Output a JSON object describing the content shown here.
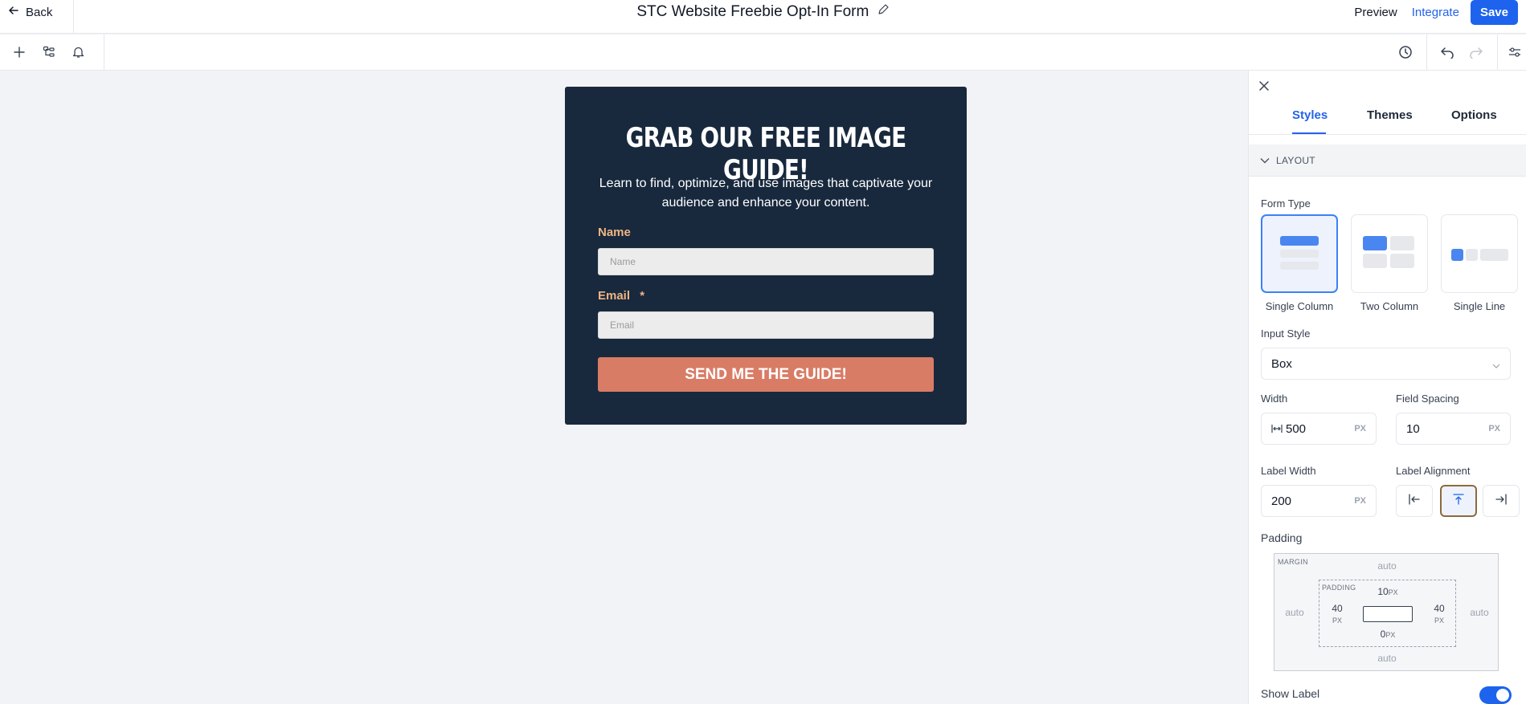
{
  "header": {
    "back_label": "Back",
    "form_title": "STC Website Freebie Opt-In Form",
    "preview_label": "Preview",
    "integrate_label": "Integrate",
    "save_label": "Save"
  },
  "toolbar": {
    "left_icons": [
      "plus-icon",
      "layers-icon",
      "bell-icon"
    ],
    "right_icons": [
      "history-icon",
      "undo-icon",
      "redo-icon",
      "sliders-icon"
    ]
  },
  "form": {
    "heading": "GRAB OUR FREE IMAGE GUIDE!",
    "subheading": "Learn to find, optimize, and use images that captivate your audience and enhance your content.",
    "name_label": "Name",
    "name_placeholder": "Name",
    "email_label": "Email",
    "email_required": "*",
    "email_placeholder": "Email",
    "button_label": "SEND ME THE GUIDE!",
    "colors": {
      "background": "#18293d",
      "label": "#f0b482",
      "button": "#d97c66"
    }
  },
  "panel": {
    "tabs": [
      {
        "label": "Styles",
        "active": true
      },
      {
        "label": "Themes",
        "active": false
      },
      {
        "label": "Options",
        "active": false
      }
    ],
    "section_title": "LAYOUT",
    "form_type": {
      "label": "Form Type",
      "options": [
        {
          "label": "Single Column",
          "selected": true
        },
        {
          "label": "Two Column",
          "selected": false
        },
        {
          "label": "Single Line",
          "selected": false
        }
      ]
    },
    "input_style": {
      "label": "Input Style",
      "value": "Box"
    },
    "width": {
      "label": "Width",
      "value": "500",
      "unit": "PX"
    },
    "field_spacing": {
      "label": "Field Spacing",
      "value": "10",
      "unit": "PX"
    },
    "label_width": {
      "label": "Label Width",
      "value": "200",
      "unit": "PX"
    },
    "label_alignment": {
      "label": "Label Alignment",
      "selected": "top"
    },
    "padding": {
      "label": "Padding",
      "margin_caption": "MARGIN",
      "padding_caption": "PADDING",
      "margin_top": "auto",
      "margin_right": "auto",
      "margin_bottom": "auto",
      "margin_left": "auto",
      "padding_top": "10",
      "padding_right": "40",
      "padding_bottom": "0",
      "padding_left": "40",
      "unit": "PX"
    },
    "show_label": {
      "label": "Show Label",
      "enabled": true
    },
    "accent_color": "#1d63ed"
  }
}
